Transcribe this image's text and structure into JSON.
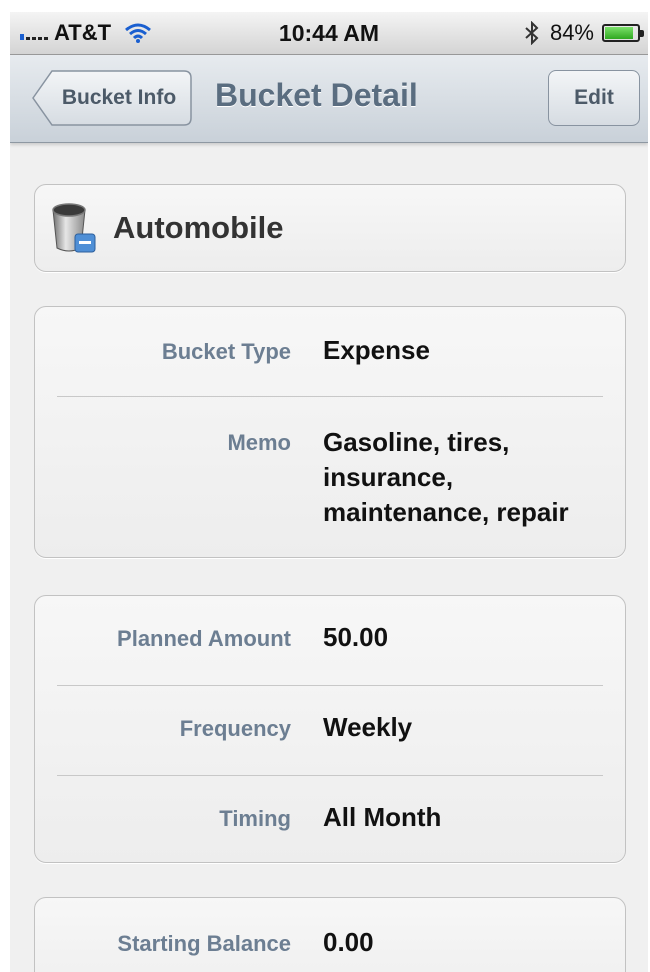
{
  "status_bar": {
    "carrier": "AT&T",
    "time": "10:44 AM",
    "battery": "84%",
    "icons": [
      "signal-icon",
      "wifi-icon",
      "bluetooth-icon",
      "battery-icon"
    ]
  },
  "nav": {
    "back_label": "Bucket Info",
    "title": "Bucket Detail",
    "edit_label": "Edit"
  },
  "bucket": {
    "name": "Automobile",
    "icon": "bucket-icon"
  },
  "details": {
    "type_label": "Bucket Type",
    "type_value": "Expense",
    "memo_label": "Memo",
    "memo_value": "Gasoline, tires, insurance, maintenance, repair"
  },
  "plan": {
    "planned_label": "Planned Amount",
    "planned_value": "50.00",
    "frequency_label": "Frequency",
    "frequency_value": "Weekly",
    "timing_label": "Timing",
    "timing_value": "All Month"
  },
  "balance": {
    "starting_label": "Starting Balance",
    "starting_value": "0.00"
  },
  "colors": {
    "label": "#6c7e92",
    "nav_title": "#5a6d80",
    "battery_fill": "#2fa821"
  }
}
